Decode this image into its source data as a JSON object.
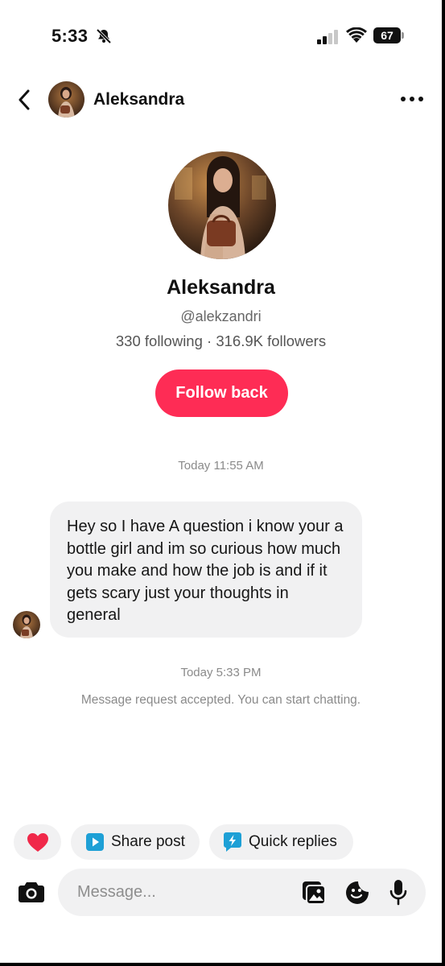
{
  "status_bar": {
    "time": "5:33",
    "battery": "67",
    "icons": [
      "bell-slash-icon",
      "signal-icon",
      "wifi-icon",
      "battery-icon"
    ]
  },
  "header": {
    "name": "Aleksandra",
    "icons": [
      "back-chevron-icon",
      "more-dots-icon"
    ]
  },
  "profile": {
    "name": "Aleksandra",
    "handle": "@alekzandri",
    "stats": "330 following · 316.9K followers",
    "follow_button": "Follow back"
  },
  "chat": {
    "timestamp_1": "Today 11:55 AM",
    "message": "Hey so I have A question i know your a bottle girl and im so curious how much you make and how the job is and if it gets scary just your thoughts in general",
    "timestamp_2": "Today 5:33 PM",
    "system_note": "Message request accepted. You can start chatting."
  },
  "quick_actions": {
    "heart_icon": "heart-icon",
    "share_post": "Share post",
    "quick_replies": "Quick replies"
  },
  "composer": {
    "placeholder": "Message...",
    "icons": [
      "camera-icon",
      "gallery-icon",
      "sticker-icon",
      "mic-icon"
    ]
  },
  "colors": {
    "accent": "#fe2c55",
    "bubble": "#f1f1f2",
    "muted_text": "#8a8a8a",
    "share_icon": "#1ea0d6",
    "quick_icon": "#1ea0d6"
  }
}
